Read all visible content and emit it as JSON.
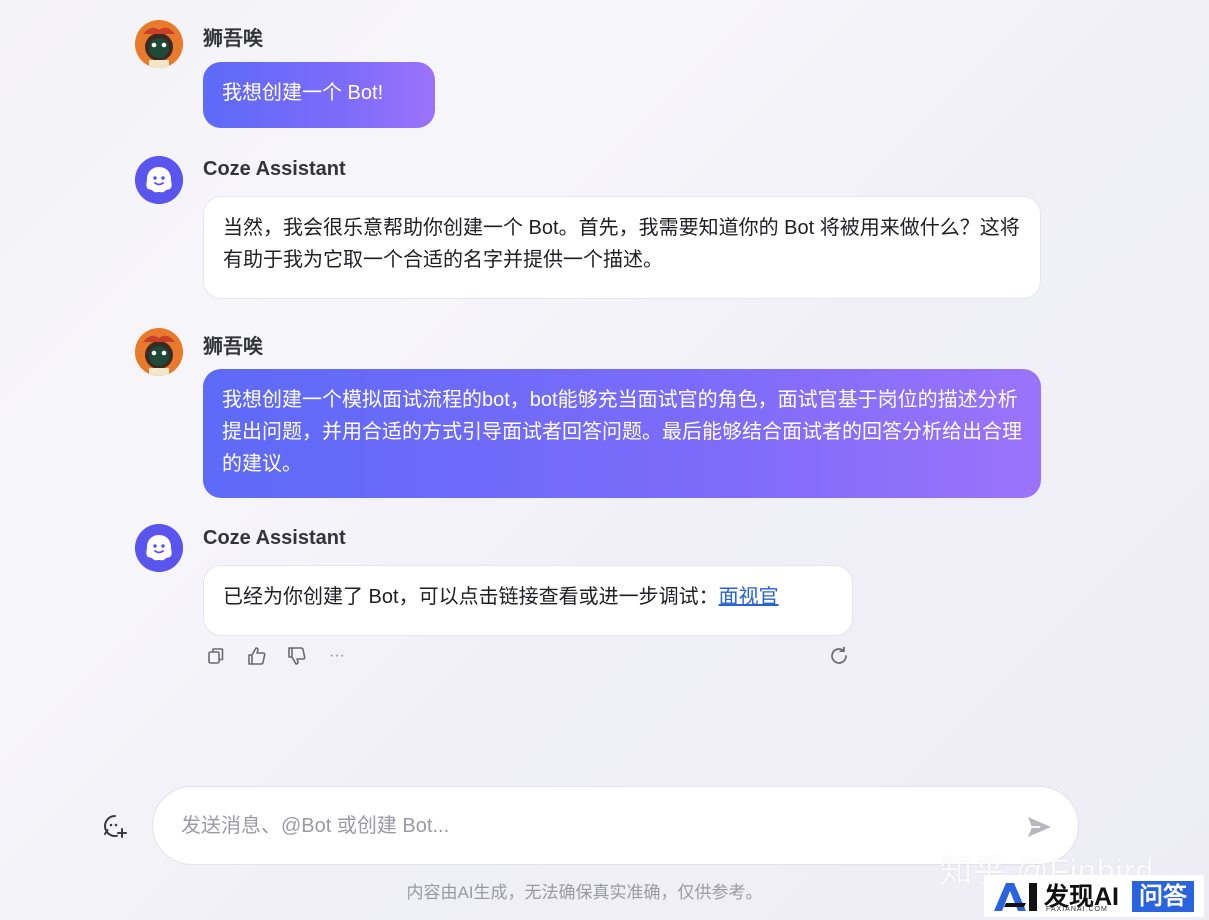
{
  "conversation": {
    "messages": [
      {
        "role": "user",
        "sender": "狮吾唉",
        "text": "我想创建一个 Bot!"
      },
      {
        "role": "assistant",
        "sender": "Coze Assistant",
        "text": "当然，我会很乐意帮助你创建一个 Bot。首先，我需要知道你的 Bot 将被用来做什么？这将有助于我为它取一个合适的名字并提供一个描述。"
      },
      {
        "role": "user",
        "sender": "狮吾唉",
        "text": "我想创建一个模拟面试流程的bot，bot能够充当面试官的角色，面试官基于岗位的描述分析提出问题，并用合适的方式引导面试者回答问题。最后能够结合面试者的回答分析给出合理的建议。"
      },
      {
        "role": "assistant",
        "sender": "Coze Assistant",
        "text": "已经为你创建了 Bot，可以点击链接查看或进一步调试：",
        "link_text": "面视官"
      }
    ]
  },
  "message_actions": {
    "icons": [
      "copy-icon",
      "thumbs-up-icon",
      "thumbs-down-icon",
      "more-icon",
      "regenerate-icon"
    ],
    "more_label": "···"
  },
  "composer": {
    "placeholder": "发送消息、@Bot 或创建 Bot...",
    "value": ""
  },
  "footer": {
    "disclaimer": "内容由AI生成，无法确保真实准确，仅供参考。"
  },
  "watermarks": {
    "zhihu": "知乎 @Finbird",
    "brand_name": "发现AI",
    "brand_sub": "FAXIANAI.COM",
    "brand_badge": "问答"
  },
  "colors": {
    "user_bubble_start": "#5d6af8",
    "user_bubble_end": "#9b73fb",
    "link": "#2563d6",
    "bot_avatar": "#5b55f0",
    "user_avatar": "#f08a3a",
    "brand_badge": "#2a63e0"
  }
}
